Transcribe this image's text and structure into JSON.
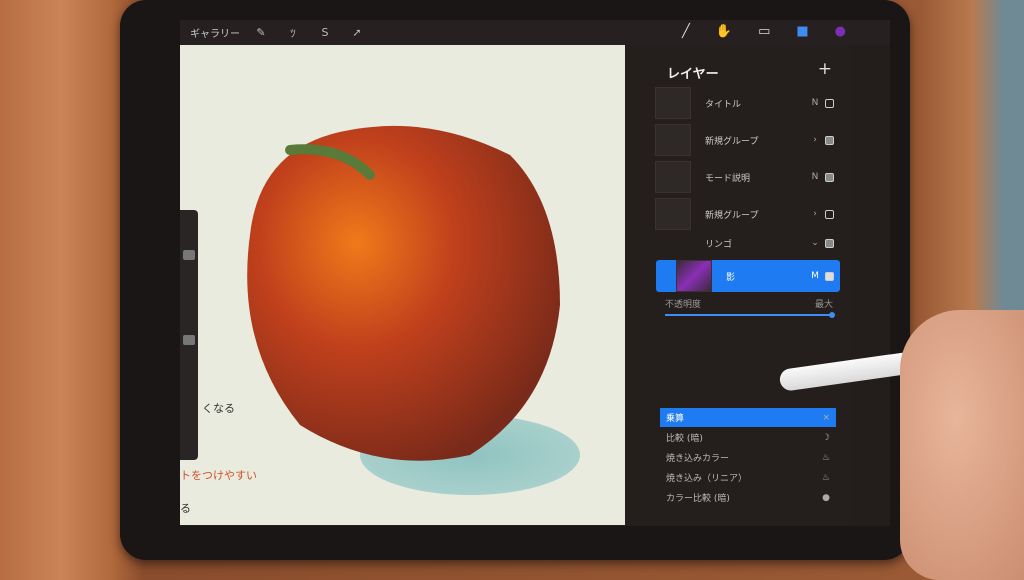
{
  "topbar": {
    "gallery": "ギャラリー",
    "icons": [
      "wrench-icon",
      "adjustments-icon",
      "selection-icon",
      "transform-icon"
    ],
    "right_icons": [
      "brush-icon",
      "smudge-icon",
      "eraser-icon",
      "layers-icon",
      "color-icon"
    ],
    "color": "#7a2fb5"
  },
  "layers_panel": {
    "title": "レイヤー",
    "add": "+",
    "layers": [
      {
        "name": "タイトル",
        "mode": "N",
        "visible": false
      },
      {
        "name": "新規グループ",
        "mode": "›",
        "visible": true
      },
      {
        "name": "モード説明",
        "mode": "N",
        "visible": true
      },
      {
        "name": "新規グループ",
        "mode": "›",
        "visible": false
      },
      {
        "name": "リンゴ",
        "mode": "⌄",
        "visible": true
      }
    ],
    "selected_layer": {
      "name": "影",
      "mode": "M",
      "visible": true
    },
    "opacity_label": "不透明度",
    "opacity_value_label": "最大",
    "opacity": 1.0,
    "blend_modes": [
      {
        "name": "乗算",
        "icon": "×"
      },
      {
        "name": "比較 (暗)",
        "icon": "☽"
      },
      {
        "name": "焼き込みカラー",
        "icon": "♨"
      },
      {
        "name": "焼き込み（リニア）",
        "icon": "♨"
      },
      {
        "name": "カラー比較 (暗)",
        "icon": "●"
      }
    ]
  },
  "canvas_notes": [
    "くなる",
    "トをつけやすい",
    "る"
  ],
  "accent": "#1f7bf2"
}
